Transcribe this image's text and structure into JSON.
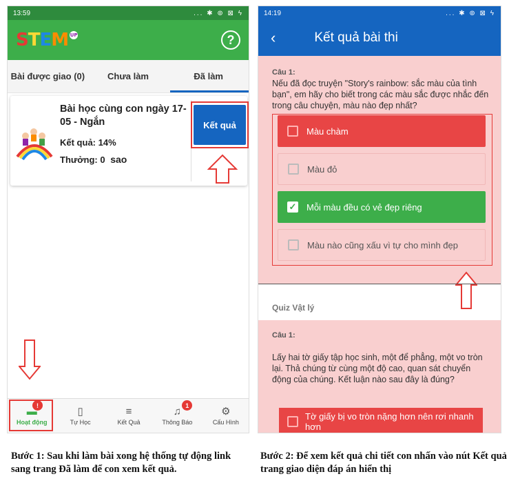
{
  "left_phone": {
    "status_time": "13:59",
    "status_icons": "... ✱ ⊚ ⊠ ϟ",
    "logo_text": [
      "S",
      "T",
      "E",
      "M",
      " "
    ],
    "logo_badge": "UP",
    "help_icon": "help-circle-icon",
    "tabs": [
      {
        "label": "Bài được giao (0)"
      },
      {
        "label": "Chưa làm"
      },
      {
        "label": "Đã làm"
      }
    ],
    "lesson": {
      "title": "Bài học cùng con ngày 17-05 - Ngắn",
      "result": "Kết quả: 14%",
      "reward_label": "Thưởng: 0",
      "reward_unit": "sao",
      "button": "Kết quả"
    },
    "nav": [
      {
        "label": "Hoạt động",
        "icon": "activity-icon",
        "badge": "!"
      },
      {
        "label": "Tự Học",
        "icon": "book-icon"
      },
      {
        "label": "Kết Quả",
        "icon": "checklist-icon"
      },
      {
        "label": "Thông Báo",
        "icon": "bell-icon",
        "badge": "1"
      },
      {
        "label": "Cấu Hình",
        "icon": "gear-icon"
      }
    ]
  },
  "right_phone": {
    "status_time": "14:19",
    "status_icons": "... ✱ ⊚ ⊠ ϟ",
    "title": "Kết quả bài thi",
    "q1": {
      "label": "Câu 1:",
      "text": "Nếu đã đọc truyện \"Story's rainbow: sắc màu của tình bạn\", em hãy cho biết trong các màu sắc được nhắc đến trong câu chuyện, màu nào đẹp nhất?",
      "answers": [
        {
          "text": "Màu chàm",
          "state": "wrong"
        },
        {
          "text": "Màu đỏ",
          "state": "plain"
        },
        {
          "text": "Mỗi màu đều có vẻ đẹp riêng",
          "state": "correct"
        },
        {
          "text": "Màu nào cũng xấu vì tự cho mình đẹp",
          "state": "plain"
        }
      ]
    },
    "quiz_title": "Quiz Vật lý",
    "q2": {
      "label": "Câu 1:",
      "text": "Lấy hai tờ giấy tập học sinh, một để phẳng, một vo tròn lại. Thả chúng từ cùng một độ cao, quan sát chuyển động của chúng. Kết luận nào sau đây là đúng?",
      "answer_partial": "Tờ giấy bị vo tròn nặng hơn nên rơi nhanh hơn"
    }
  },
  "captions": {
    "step1": "Bước 1: Sau khi làm bài xong hệ thống tự động link sang trang Đã làm để con xem kết quả.",
    "step2": "Bước 2: Để xem kết quả chi tiết con nhấn vào nút Kết quả trang giao diện đáp án hiển thị"
  },
  "colors": {
    "green": "#3dae4a",
    "blue": "#1565c0",
    "red": "#e84545",
    "pink": "#f9cfcf"
  }
}
